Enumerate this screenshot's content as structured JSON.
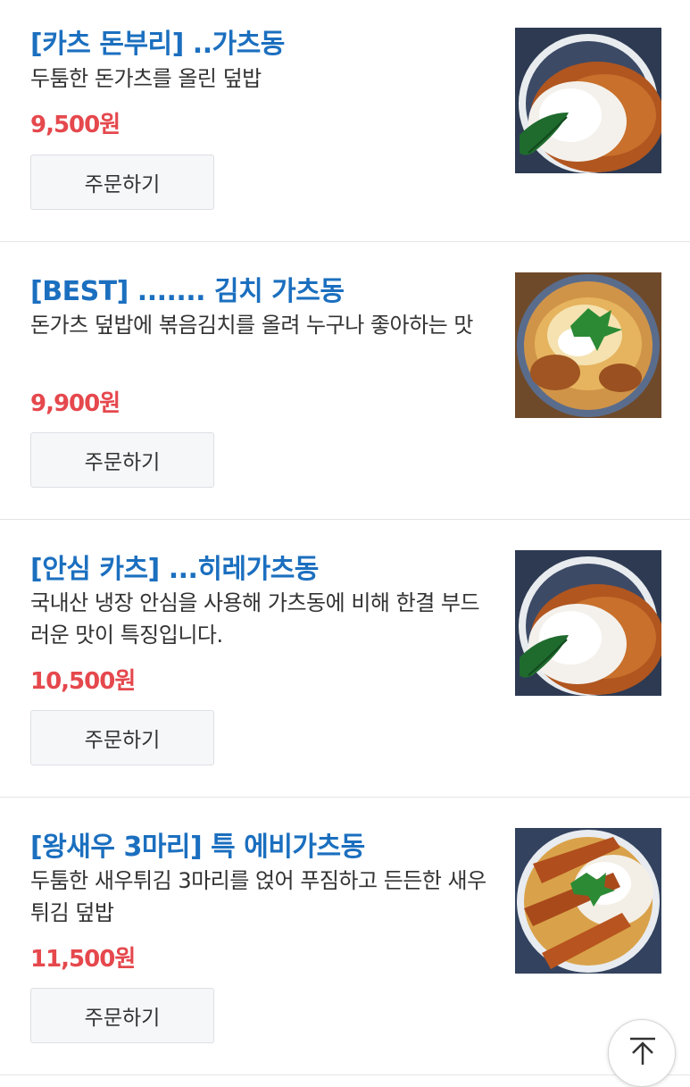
{
  "menu": {
    "items": [
      {
        "title": "[카츠 돈부리] ..가츠동",
        "description": "두툼한 돈가츠를 올린 덮밥",
        "price": "9,500원",
        "order_label": "주문하기"
      },
      {
        "title": "[BEST] ....... 김치 가츠동",
        "description": "돈가츠 덮밥에 볶음김치를 올려 누구나 좋아하는 맛",
        "price": "9,900원",
        "order_label": "주문하기"
      },
      {
        "title": "[안심 카츠] ...히레가츠동",
        "description": "국내산 냉장 안심을 사용해 가츠동에 비해 한결 부드러운 맛이 특징입니다.",
        "price": "10,500원",
        "order_label": "주문하기"
      },
      {
        "title": "[왕새우 3마리] 특 에비가츠동",
        "description": "두툼한 새우튀김 3마리를 얹어 푸짐하고 든든한 새우튀김 덮밥",
        "price": "11,500원",
        "order_label": "주문하기"
      }
    ]
  },
  "colors": {
    "title": "#1b6fbf",
    "price": "#e5484d",
    "button_bg": "#f6f7f9"
  },
  "icons": {
    "scroll_top": "arrow-up-to-line-icon"
  }
}
